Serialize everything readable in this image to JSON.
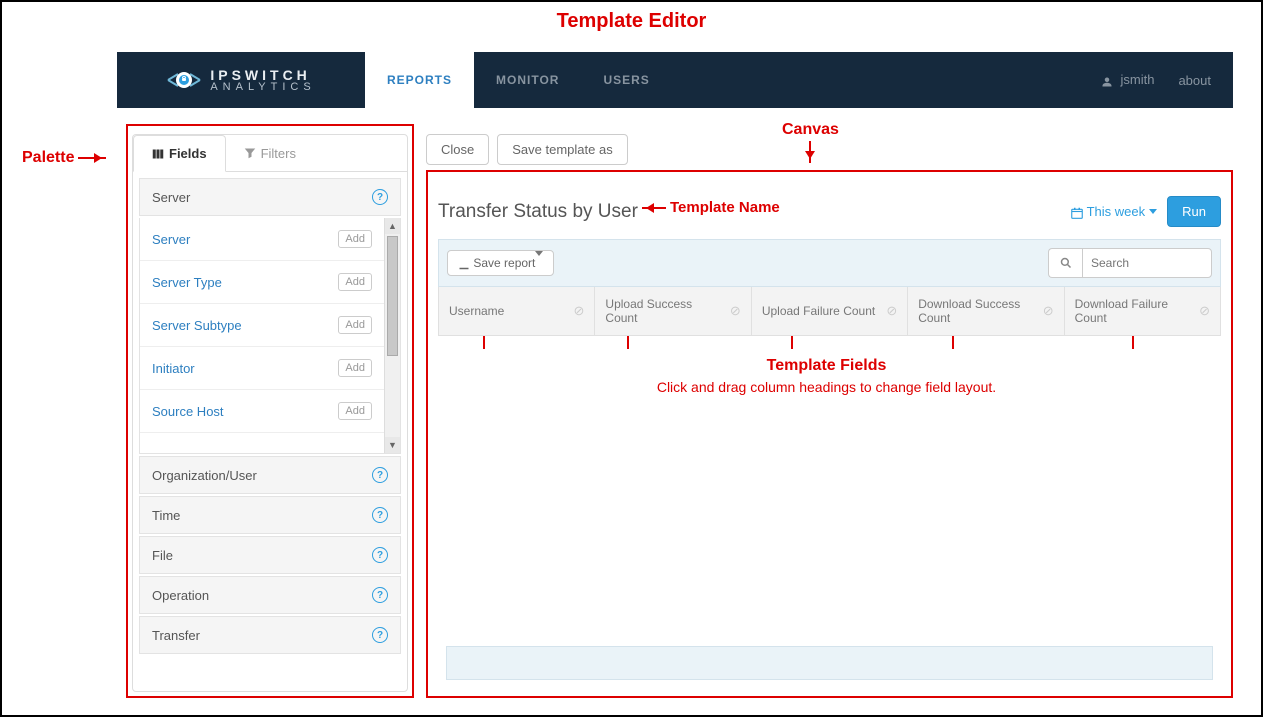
{
  "annotations": {
    "title": "Template Editor",
    "palette": "Palette",
    "canvas": "Canvas",
    "template_name": "Template Name",
    "template_fields_title": "Template Fields",
    "template_fields_sub": "Click and drag column headings to change field layout."
  },
  "brand": {
    "line1": "IPSWITCH",
    "line2": "ANALYTICS"
  },
  "nav": {
    "tabs": [
      {
        "label": "REPORTS",
        "active": true
      },
      {
        "label": "MONITOR",
        "active": false
      },
      {
        "label": "USERS",
        "active": false
      }
    ],
    "user": "jsmith",
    "about": "about"
  },
  "palette": {
    "tabs": {
      "fields": "Fields",
      "filters": "Filters"
    },
    "sections": [
      {
        "title": "Server",
        "expanded": true,
        "items": [
          {
            "label": "Server",
            "btn": "Add"
          },
          {
            "label": "Server Type",
            "btn": "Add"
          },
          {
            "label": "Server Subtype",
            "btn": "Add"
          },
          {
            "label": "Initiator",
            "btn": "Add"
          },
          {
            "label": "Source Host",
            "btn": "Add"
          }
        ]
      },
      {
        "title": "Organization/User",
        "expanded": false
      },
      {
        "title": "Time",
        "expanded": false
      },
      {
        "title": "File",
        "expanded": false
      },
      {
        "title": "Operation",
        "expanded": false
      },
      {
        "title": "Transfer",
        "expanded": false
      }
    ]
  },
  "canvas": {
    "buttons": {
      "close": "Close",
      "save_as": "Save template as"
    },
    "heading": "Transfer Status by User",
    "date_range": "This week",
    "run": "Run",
    "save_report": "Save report",
    "search_placeholder": "Search",
    "columns": [
      "Username",
      "Upload Success Count",
      "Upload Failure Count",
      "Download Success Count",
      "Download Failure Count"
    ]
  }
}
